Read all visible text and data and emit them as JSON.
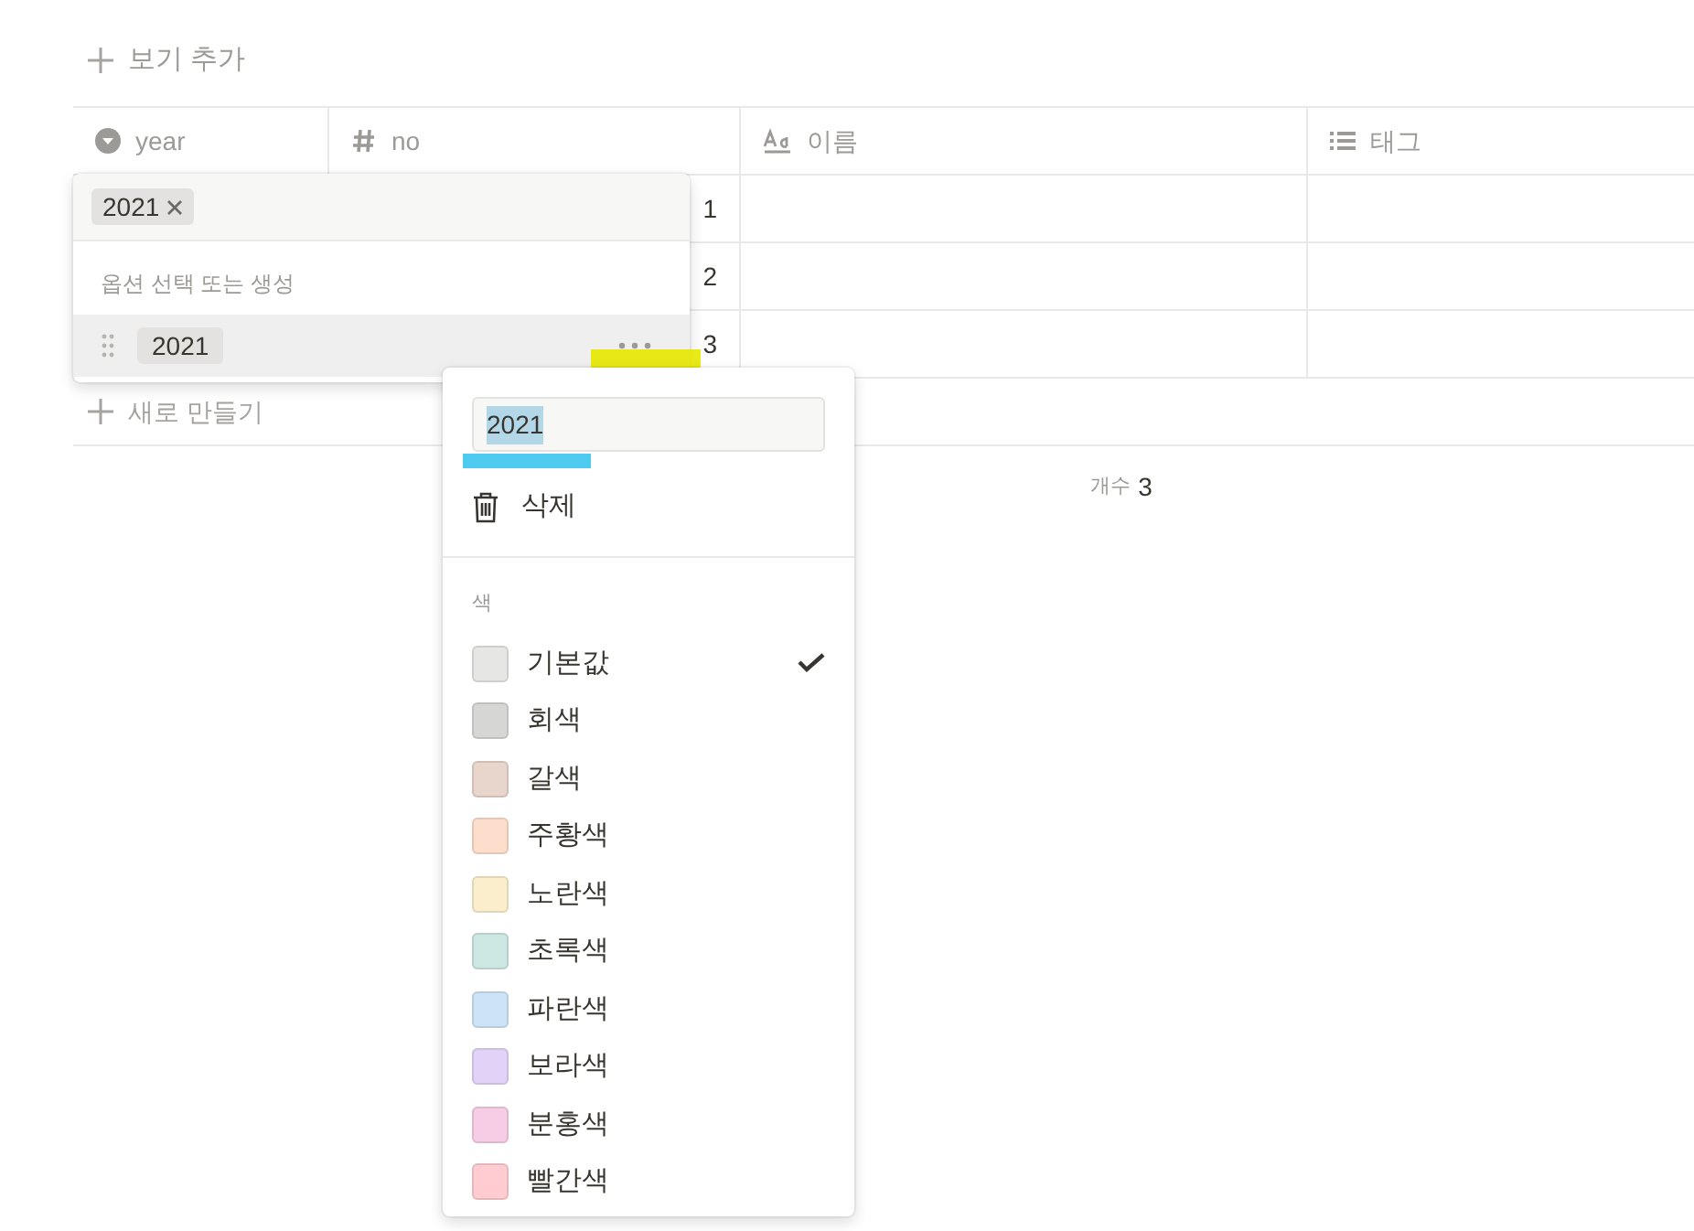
{
  "add_view": {
    "label": "보기 추가"
  },
  "table": {
    "columns": [
      {
        "kind": "select",
        "label": "year"
      },
      {
        "kind": "number",
        "label": "no"
      },
      {
        "kind": "title",
        "label": "이름"
      },
      {
        "kind": "list",
        "label": "태그"
      }
    ],
    "rows": [
      {
        "no": "1"
      },
      {
        "no": "2"
      },
      {
        "no": "3"
      }
    ],
    "new_row": {
      "label": "새로 만들기"
    },
    "footer": {
      "label": "개수",
      "value": "3"
    }
  },
  "option_picker": {
    "chosen": [
      {
        "label": "2021"
      }
    ],
    "hint": "옵션 선택 또는 생성",
    "options": [
      {
        "label": "2021",
        "hovered": true
      }
    ]
  },
  "option_menu": {
    "name_value": "2021",
    "delete": "삭제",
    "color_heading": "색",
    "colors": [
      {
        "label": "기본값",
        "color": "#e6e6e4",
        "selected": true
      },
      {
        "label": "회색",
        "color": "#d6d6d4",
        "selected": false
      },
      {
        "label": "갈색",
        "color": "#e8d5cc",
        "selected": false
      },
      {
        "label": "주황색",
        "color": "#fddecc",
        "selected": false
      },
      {
        "label": "노란색",
        "color": "#fbeecc",
        "selected": false
      },
      {
        "label": "초록색",
        "color": "#cce6e1",
        "selected": false
      },
      {
        "label": "파란색",
        "color": "#cde4f7",
        "selected": false
      },
      {
        "label": "보라색",
        "color": "#e1d3f7",
        "selected": false
      },
      {
        "label": "분홍색",
        "color": "#f7cde6",
        "selected": false
      },
      {
        "label": "빨간색",
        "color": "#ffccd1",
        "selected": false
      }
    ]
  }
}
